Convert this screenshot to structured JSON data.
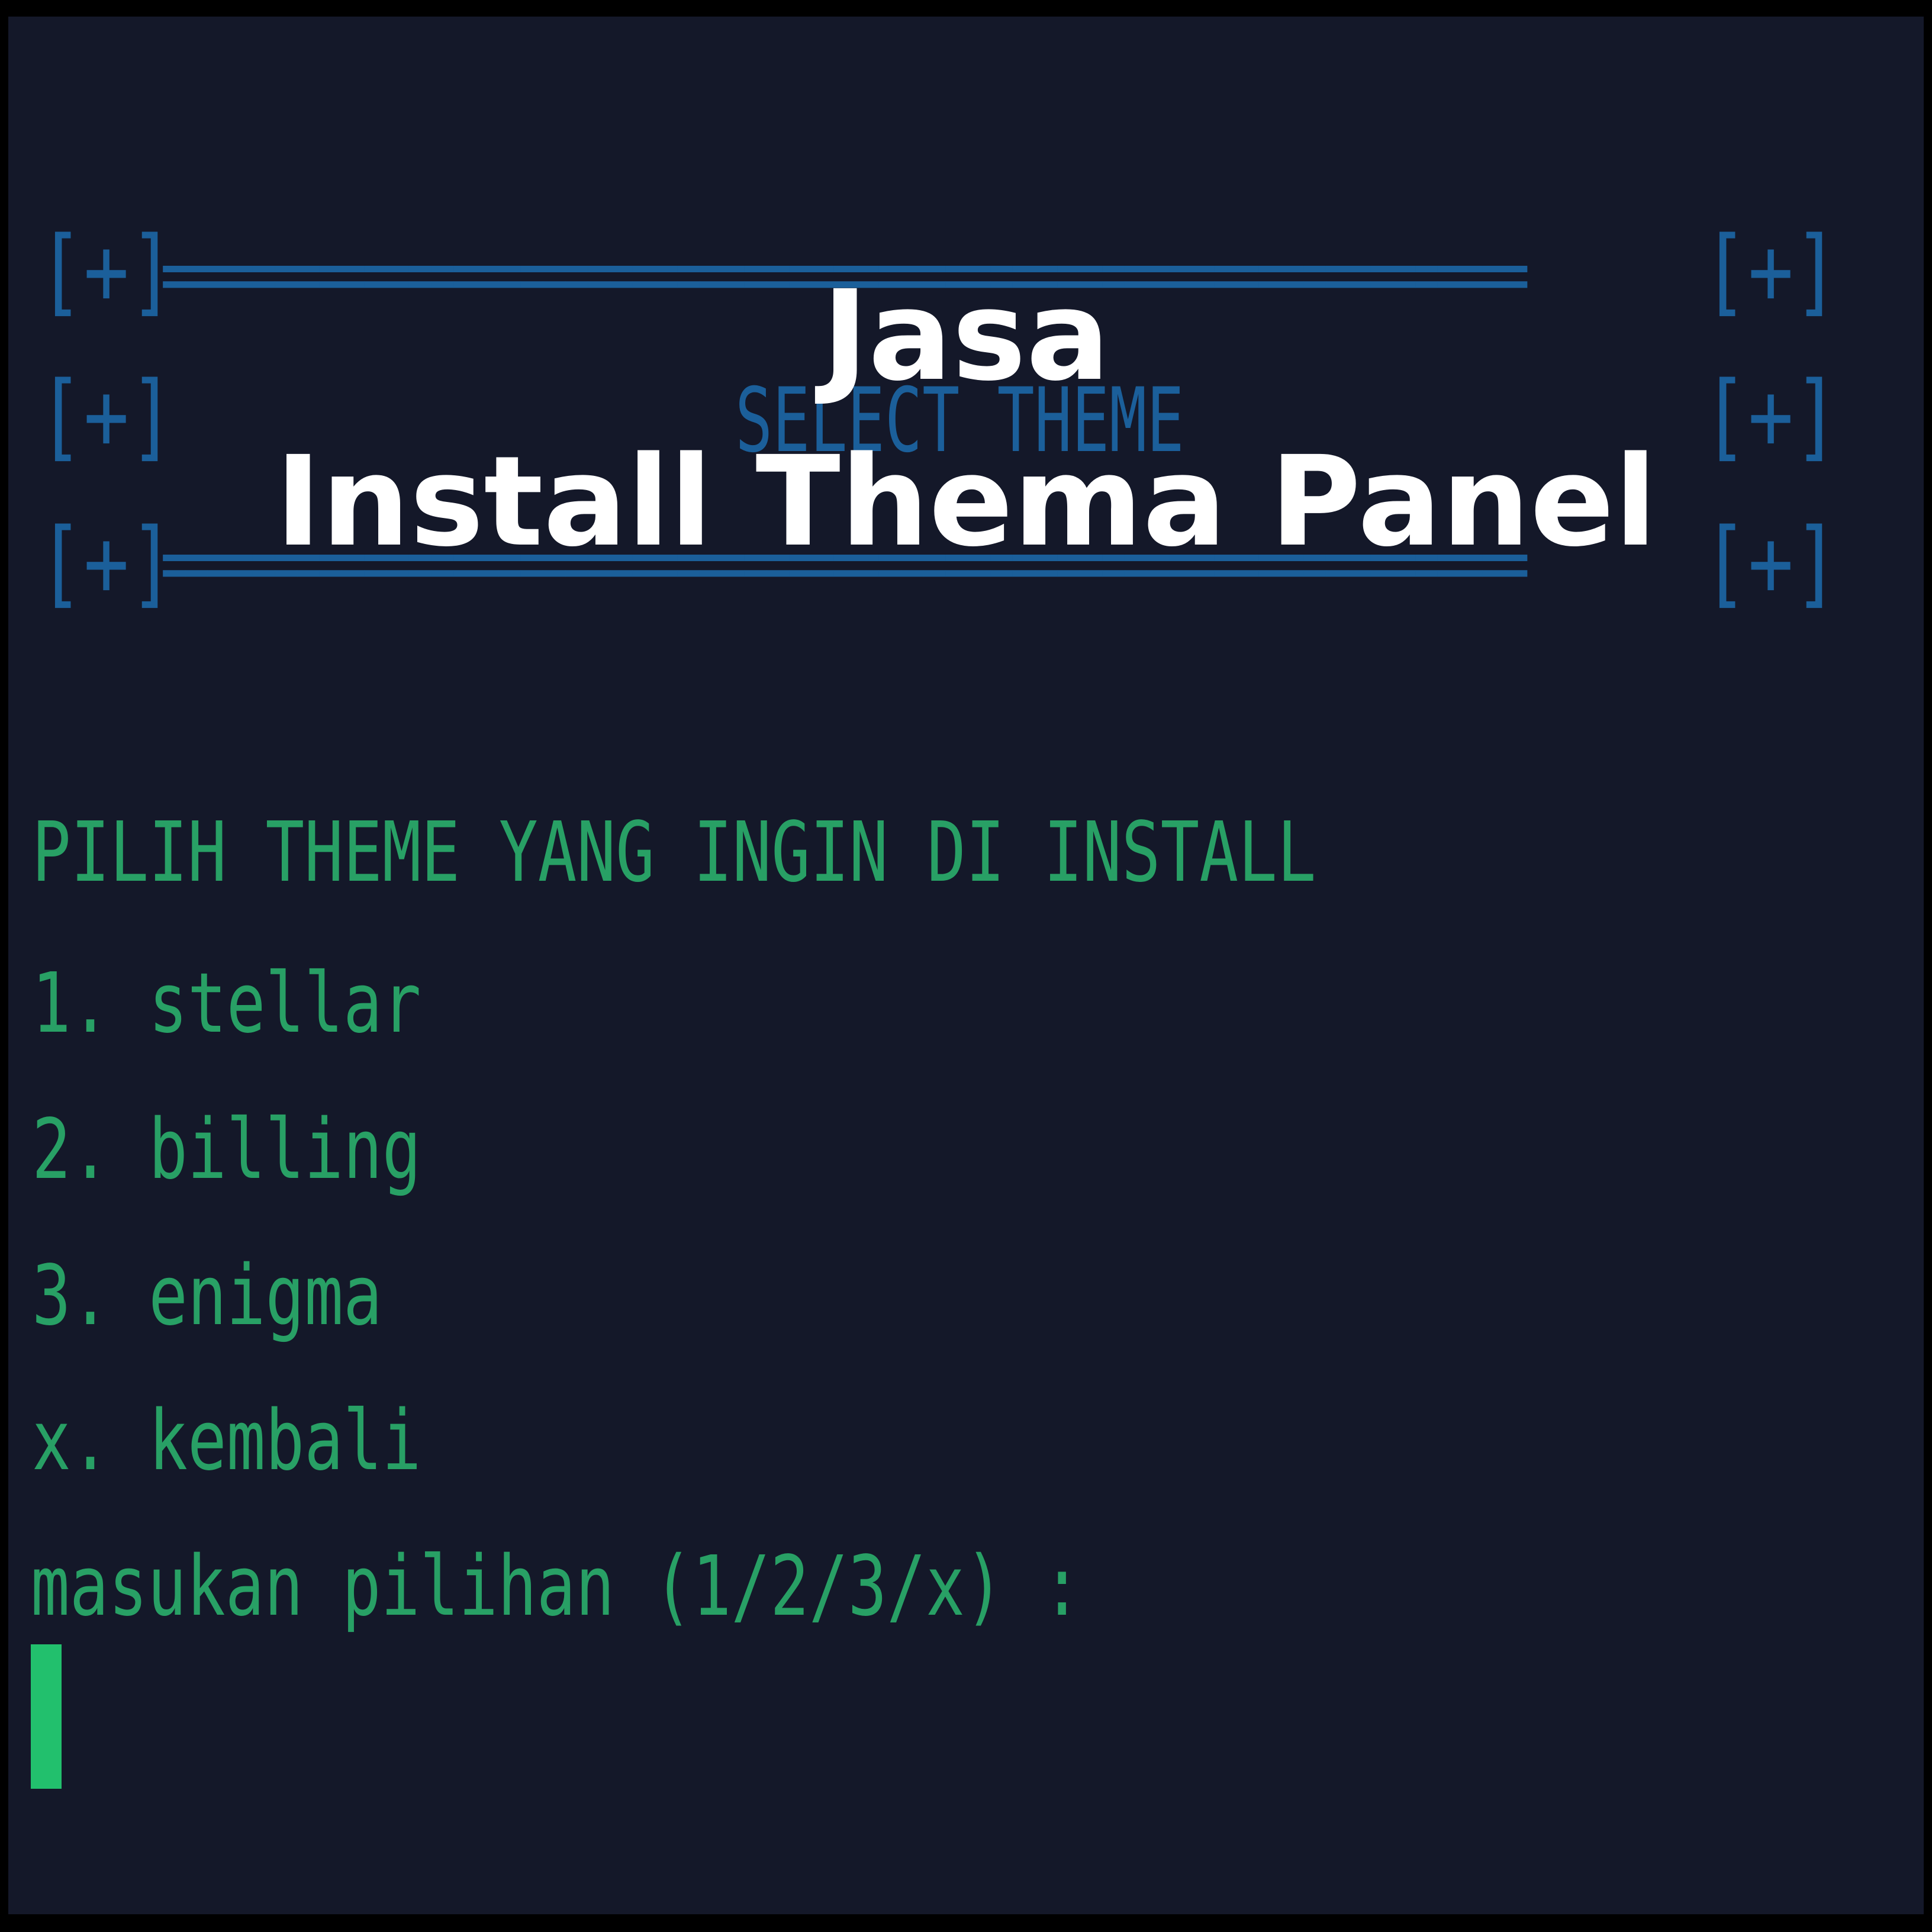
{
  "banner": {
    "bracket_left_top": "[+]",
    "bracket_right_top": "[+]",
    "bracket_left_mid": "[+]",
    "bracket_right_mid": "[+]",
    "bracket_left_bottom": "[+]",
    "bracket_right_bottom": "[+]",
    "rule_top": "=============================================================",
    "rule_bottom": "=============================================================",
    "title": "SELECT THEME"
  },
  "overlay": {
    "line1": "Jasa",
    "line2": "Install Thema Panel"
  },
  "menu": {
    "heading": "PILIH THEME YANG INGIN DI INSTALL",
    "options": [
      "1. stellar",
      "2. billing",
      "3. enigma",
      "x. kembali"
    ],
    "prompt": "masukan pilihan (1/2/3/x) :"
  },
  "colors": {
    "background": "#141829",
    "banner": "#1b5f9a",
    "menu_text": "#28a065",
    "cursor": "#22c06d",
    "overlay_text": "#ffffff"
  }
}
